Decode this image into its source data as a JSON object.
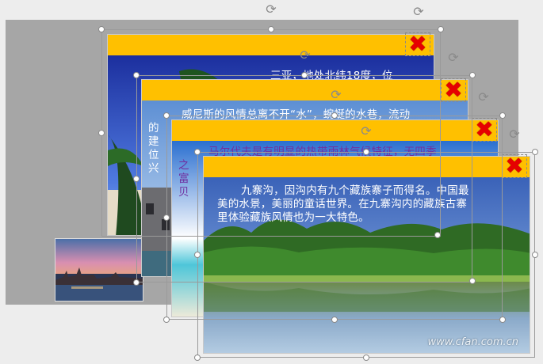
{
  "colors": {
    "canvas": "#a6a6a6",
    "title_bar": "#ffc000",
    "close_icon": "#e60000",
    "text_white": "#ffffff",
    "text_purple": "#7030a0"
  },
  "close_glyph": "✖",
  "rotate_glyph": "⟳",
  "cards": [
    {
      "text_lines": [
        "三亚，地处北纬18度，位"
      ]
    },
    {
      "text_lines": [
        "威尼斯的风情总离不开“水”，蜿蜒的水巷，流动",
        "的",
        "建",
        "位",
        "兴"
      ]
    },
    {
      "text_lines": [
        "马尔代夫是有明显的热带雨林气候特征，无四季",
        "之",
        "富",
        "贝"
      ]
    },
    {
      "text_lines": [
        "九寨沟，因沟内有九个藏族寨子而得名。中国最",
        "美的水景，美丽的童话世界。在九寨沟内的藏族古寨",
        "里体验藏族风情也为一大特色。"
      ]
    }
  ],
  "watermark": "www.cfan.com.cn"
}
